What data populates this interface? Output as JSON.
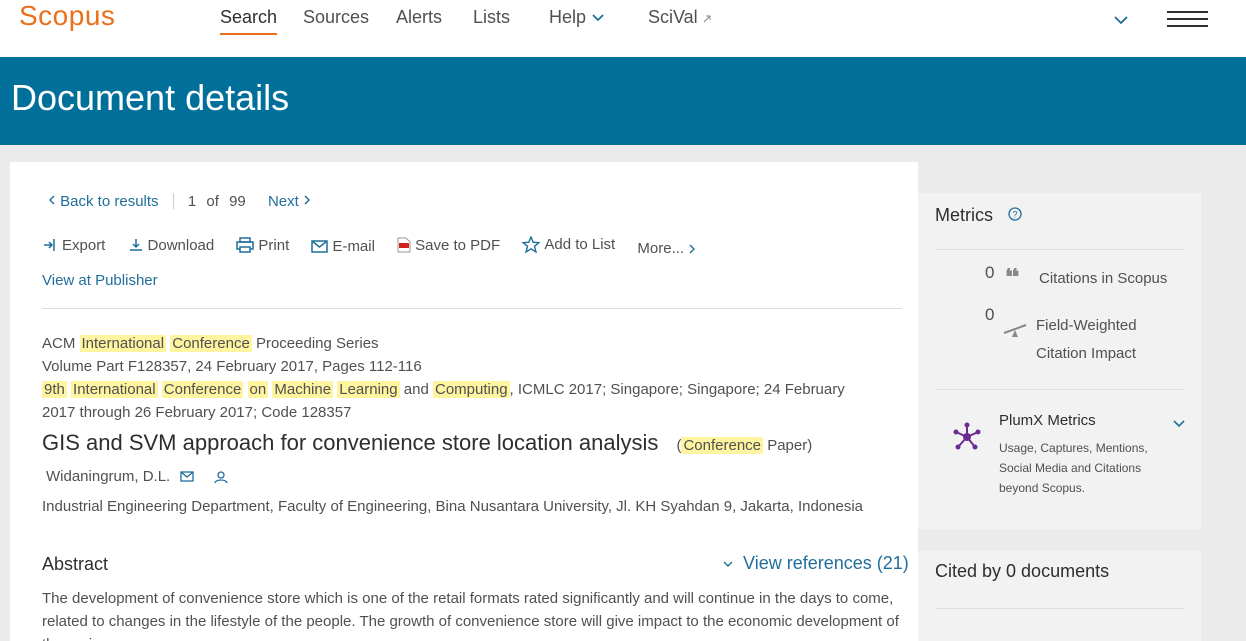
{
  "nav": {
    "logo": "Scopus",
    "items": [
      "Search",
      "Sources",
      "Alerts",
      "Lists",
      "Help",
      "SciVal"
    ]
  },
  "banner": {
    "title": "Document details"
  },
  "pagination": {
    "back": "Back to results",
    "current": "1",
    "of": "of",
    "total": "99",
    "next": "Next"
  },
  "toolbar": {
    "export": "Export",
    "download": "Download",
    "print": "Print",
    "email": "E-mail",
    "save_pdf": "Save to PDF",
    "add_list": "Add to List",
    "more": "More..."
  },
  "view_publisher": "View at Publisher",
  "source": {
    "line1": [
      "ACM ",
      "International",
      " ",
      "Conference",
      " Proceeding Series"
    ],
    "line2": "Volume Part F128357, 24 February 2017, Pages 112-116",
    "line3": [
      "9th",
      " ",
      "International",
      " ",
      "Conference",
      " ",
      "on",
      " ",
      "Machine",
      " ",
      "Learning",
      " and ",
      "Computing",
      ", ICMLC 2017; Singapore; Singapore; 24 February"
    ],
    "line4": "2017 through 26 February 2017; Code 128357"
  },
  "document": {
    "title": "GIS and SVM approach for convenience store location analysis",
    "type_paren_open": "(",
    "type_hl": "Conference",
    "type_rest": " Paper)",
    "author": "Widaningrum, D.L.",
    "affiliation": "Industrial Engineering Department, Faculty of Engineering, Bina Nusantara University, Jl. KH Syahdan 9, Jakarta, Indonesia"
  },
  "abstract": {
    "heading": "Abstract",
    "view_refs": "View references (21)",
    "text": "The development of convenience store which is one of the retail formats rated significantly and will continue in the days to come, related to changes in the lifestyle of the people. The growth of convenience store will give impact to the economic development of the region."
  },
  "metrics": {
    "heading": "Metrics",
    "citations_value": "0",
    "citations_label": "Citations in Scopus",
    "fwci_value": "0",
    "fwci_label1": "Field-Weighted",
    "fwci_label2": "Citation Impact",
    "plumx_title": "PlumX Metrics",
    "plumx_desc1": "Usage, Captures, Mentions,",
    "plumx_desc2": "Social Media and Citations",
    "plumx_desc3": "beyond Scopus."
  },
  "cited_by": {
    "heading": "Cited by 0 documents"
  },
  "colors": {
    "brand": "#e9711c",
    "banner": "#00709b",
    "link": "#1f6e9b",
    "highlight": "#fff4a0"
  }
}
